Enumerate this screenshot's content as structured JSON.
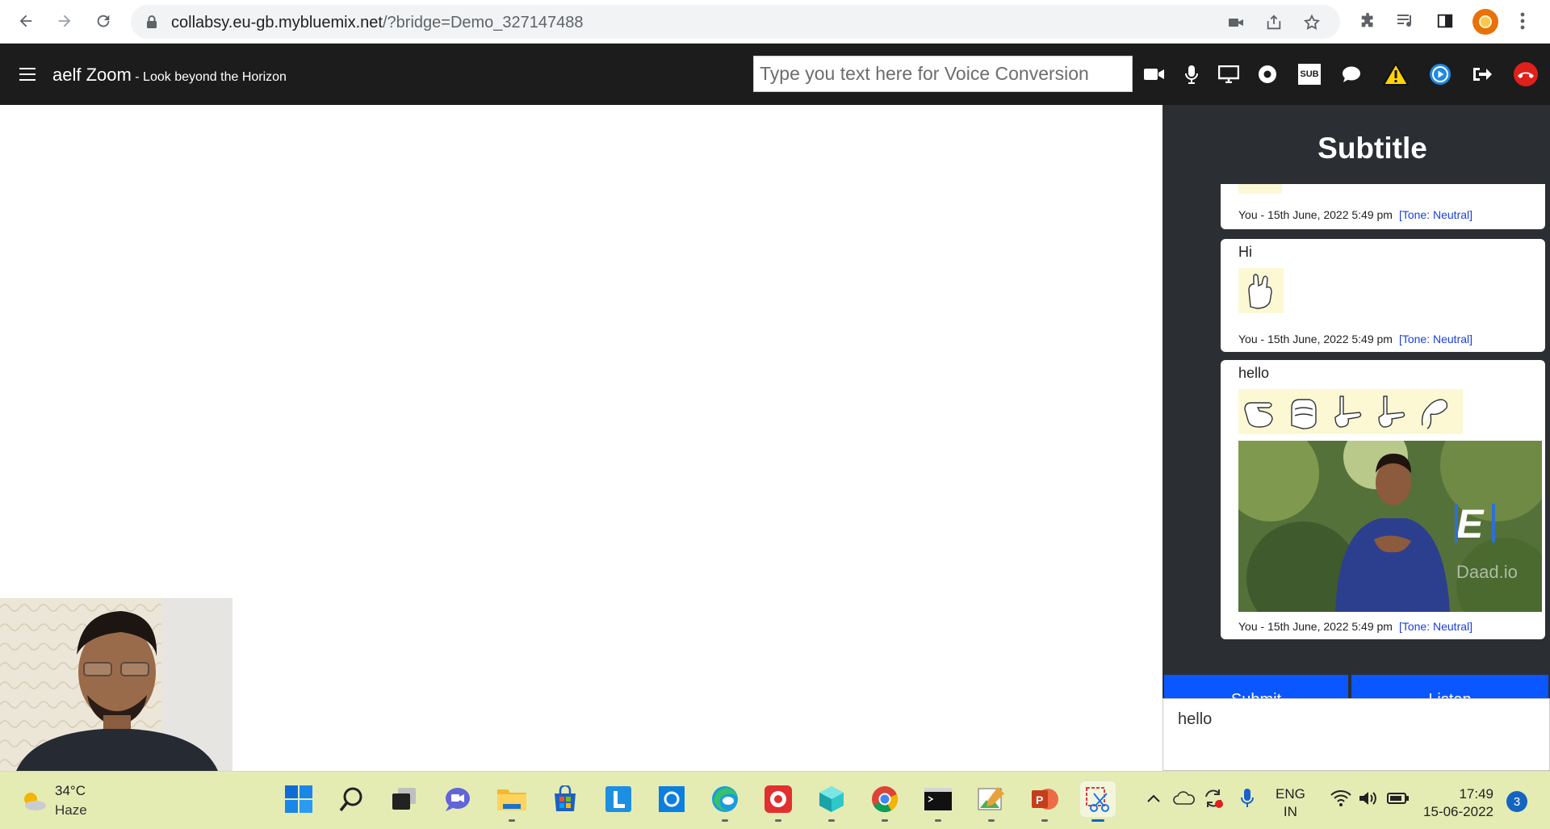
{
  "browser": {
    "url_host": "collabsy.eu-gb.mybluemix.net",
    "url_path": "/?bridge=Demo_327147488"
  },
  "header": {
    "app_name": "aelf Zoom",
    "tagline": " - Look beyond the Horizon",
    "voice_placeholder": "Type you text here for Voice Conversion",
    "sub_label": "SUB"
  },
  "subtitle_panel": {
    "title": "Subtitle",
    "messages": [
      {
        "text": "",
        "author": "You - 15th June, 2022 5:49 pm",
        "tone": "[Tone: Neutral]"
      },
      {
        "text": "Hi",
        "author": "You - 15th June, 2022 5:49 pm",
        "tone": "[Tone: Neutral]"
      },
      {
        "text": "hello",
        "author": "You - 15th June, 2022 5:49 pm",
        "tone": "[Tone: Neutral]"
      }
    ],
    "video_watermark": "Daad.io",
    "video_logo": "E",
    "buttons": [
      "Submit",
      "Listen"
    ],
    "text_value": "hello"
  },
  "taskbar": {
    "weather_temp": "34°C",
    "weather_cond": "Haze",
    "lang_1": "ENG",
    "lang_2": "IN",
    "time": "17:49",
    "date": "15-06-2022",
    "notifications": "3"
  },
  "colors": {
    "header_bg": "#1c1c1c",
    "panel_bg": "#2b2f33",
    "tone_link": "#1a3fe0",
    "button_blue": "#0a57ff",
    "taskbar_bg": "#e4ecb4",
    "hangup_red": "#e0201b"
  }
}
